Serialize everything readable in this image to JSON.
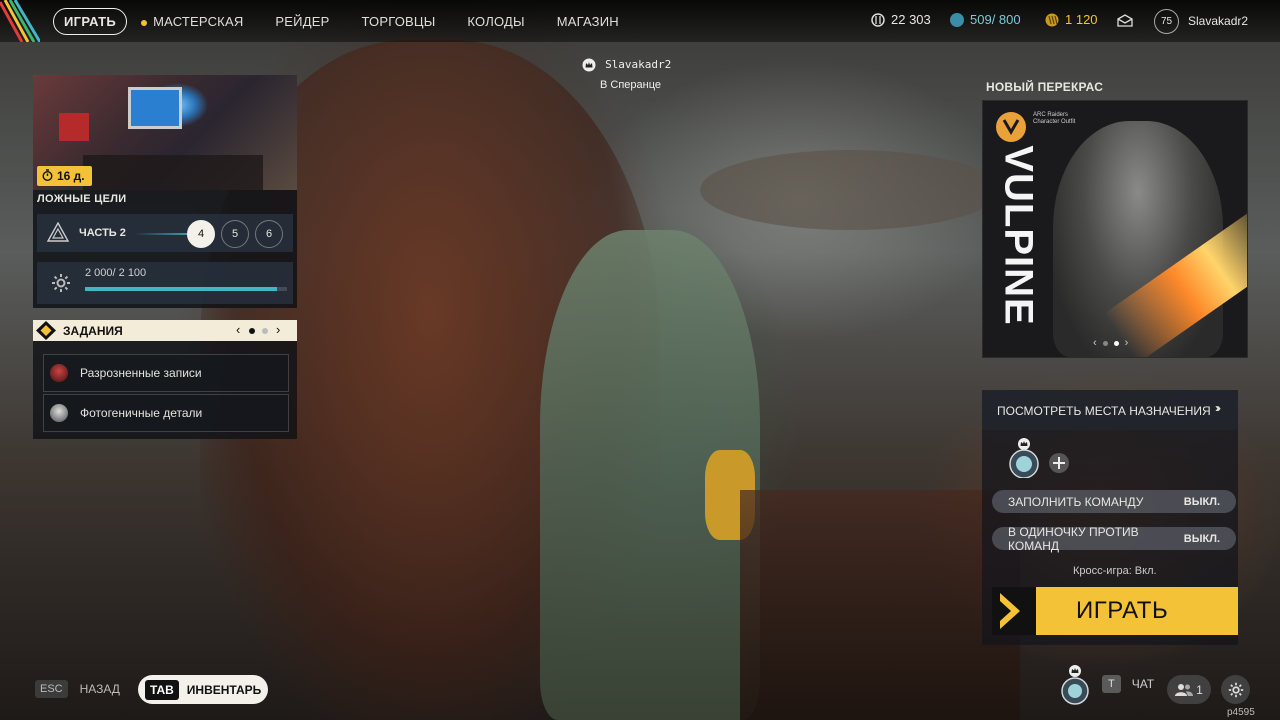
{
  "topbar": {
    "nav": {
      "play": "ИГРАТЬ",
      "workshop": "МАСТЕРСКАЯ",
      "raider": "РЕЙДЕР",
      "traders": "ТОРГОВЦЫ",
      "decks": "КОЛОДЫ",
      "shop": "МАГАЗИН"
    },
    "currency": {
      "coins": "22 303",
      "stash": "509/ 800",
      "raider_tokens": "1 120"
    },
    "player": {
      "level": "75",
      "name": "Slavakadr2"
    }
  },
  "player_tag": {
    "name": "Slavakadr2",
    "location": "В Сперанце"
  },
  "event": {
    "timer": "16 д.",
    "title": "ЛОЖНЫЕ ЦЕЛИ",
    "part_label": "ЧАСТЬ 2",
    "steps": [
      "4",
      "5",
      "6"
    ],
    "progress_text": "2 000/ 2 100",
    "progress_fraction": 0.952
  },
  "tasks": {
    "title": "ЗАДАНИЯ",
    "items": [
      {
        "label": "Разрозненные записи"
      },
      {
        "label": "Фотогеничные детали"
      }
    ]
  },
  "bottom_left": {
    "esc_key": "ESC",
    "back_label": "НАЗАД",
    "tab_key": "TAB",
    "inventory_label": "ИНВЕНТАРЬ"
  },
  "reskin": {
    "label": "НОВЫЙ ПЕРЕКРАС",
    "brand_small_1": "ARC Raiders",
    "brand_small_2": "Character Outfit",
    "name": "VULPINE"
  },
  "right_panel": {
    "destinations": "ПОСМОТРЕТЬ МЕСТА НАЗНАЧЕНИЯ",
    "fill_team": "ЗАПОЛНИТЬ КОМАНДУ",
    "fill_team_value": "ВЫКЛ.",
    "solo_vs_teams": "В ОДИНОЧКУ ПРОТИВ КОМАНД",
    "solo_vs_teams_value": "ВЫКЛ.",
    "crossplay": "Кросс-игра: Вкл.",
    "play": "ИГРАТЬ"
  },
  "bottom_right": {
    "chat_key": "T",
    "chat_label": "ЧАТ",
    "friends_count": "1"
  },
  "build_id": "p4595",
  "colors": {
    "accent": "#f3c236",
    "cyan": "#3fb7c8"
  }
}
